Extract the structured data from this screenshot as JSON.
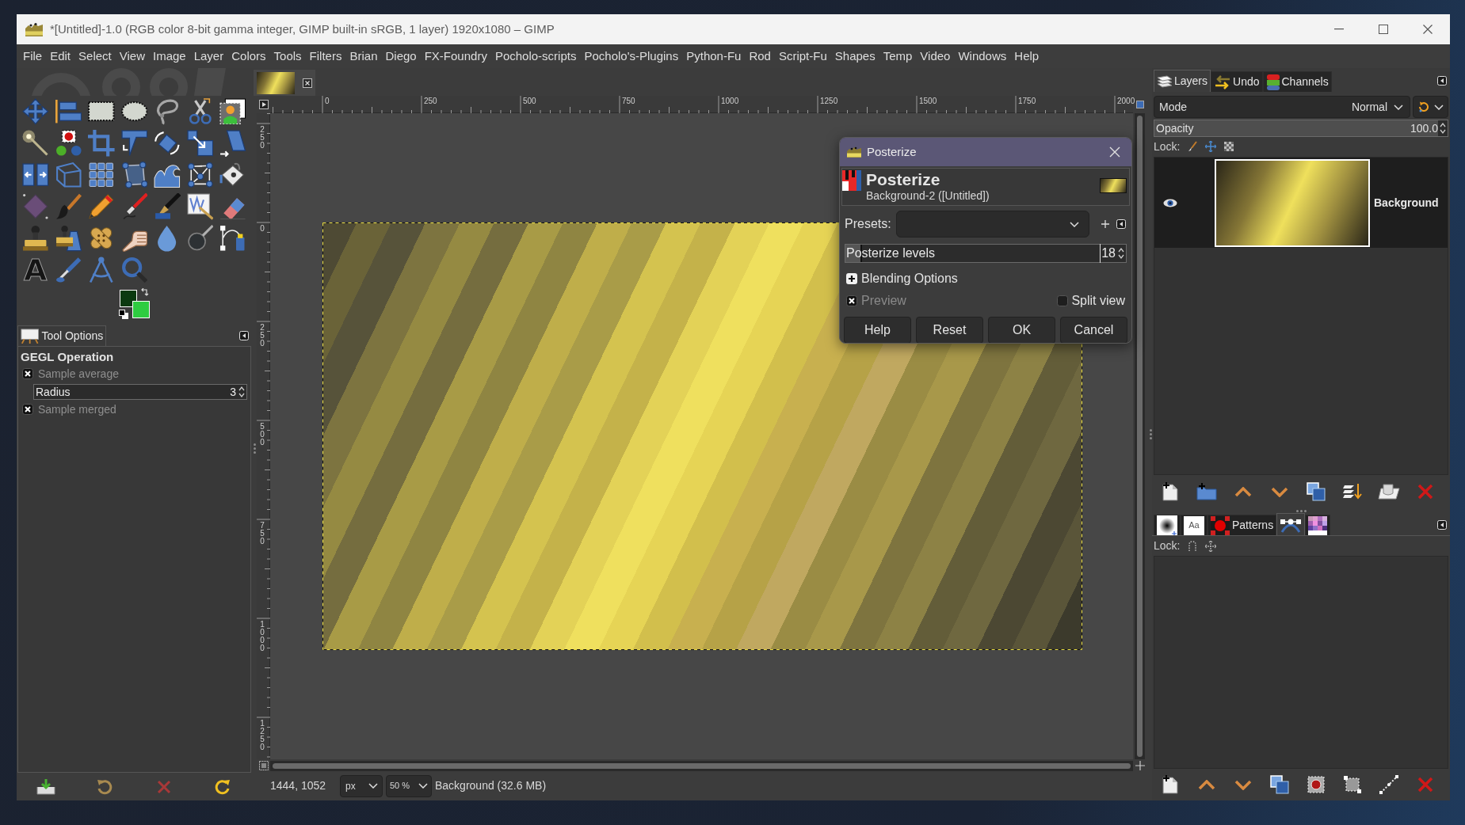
{
  "window": {
    "title": "*[Untitled]-1.0 (RGB color 8-bit gamma integer, GIMP built-in sRGB, 1 layer) 1920x1080 – GIMP"
  },
  "menu_bar": [
    "File",
    "Edit",
    "Select",
    "View",
    "Image",
    "Layer",
    "Colors",
    "Tools",
    "Filters",
    "Brian",
    "Diego",
    "FX-Foundry",
    "Pocholo-scripts",
    "Pocholo's-Plugins",
    "Python-Fu",
    "Rod",
    "Script-Fu",
    "Shapes",
    "Temp",
    "Video",
    "Windows",
    "Help"
  ],
  "toolbox": {
    "text_tool_glyph": "A"
  },
  "tool_options": {
    "tab": "Tool Options",
    "heading": "GEGL Operation",
    "options": [
      {
        "kind": "checkbox",
        "label": "Sample average",
        "checked": true,
        "disabled": true
      },
      {
        "kind": "spin",
        "label": "Radius",
        "value": "3"
      },
      {
        "kind": "checkbox",
        "label": "Sample merged",
        "checked": true,
        "disabled": true
      }
    ]
  },
  "rulers": {
    "horizontal": [
      "0",
      "250",
      "500",
      "750",
      "1000",
      "1250",
      "1500",
      "1750",
      "2000"
    ],
    "vertical": [
      "250",
      "0",
      "250",
      "500",
      "750",
      "1000",
      "1250"
    ]
  },
  "posterize_dialog": {
    "title": "Posterize",
    "heading": "Posterize",
    "subtitle": "Background-2 ([Untitled])",
    "presets": {
      "label": "Presets:"
    },
    "levels": {
      "label": "Posterize levels",
      "value": "18",
      "level": 0.06
    },
    "blending_options": {
      "label": "Blending Options",
      "expanded": false
    },
    "preview": {
      "label": "Preview",
      "checked": true,
      "disabled": true
    },
    "split_view": {
      "label": "Split view",
      "checked": false
    },
    "buttons": [
      "Help",
      "Reset",
      "OK",
      "Cancel"
    ]
  },
  "status_bar": {
    "coordinates": "1444, 1052",
    "unit": "px",
    "zoom": "50 %",
    "message": "Background (32.6 MB)"
  },
  "layers_dock": {
    "tabs": [
      {
        "kind": "layers",
        "label": "Layers",
        "selected": true
      },
      {
        "kind": "undo",
        "label": "Undo",
        "selected": false
      },
      {
        "kind": "channels",
        "label": "Channels",
        "selected": false
      }
    ],
    "mode": {
      "label": "Mode",
      "value": "Normal"
    },
    "opacity": {
      "label": "Opacity",
      "value": "100.0",
      "level": 1
    },
    "lock_label": "Lock:",
    "layers": [
      {
        "name": "Background",
        "visible": true,
        "selected": true
      }
    ]
  },
  "lower_dock": {
    "tabs": [
      {
        "kind": "brushes",
        "selected": false
      },
      {
        "kind": "fonts",
        "glyph": "Aa",
        "selected": false
      },
      {
        "kind": "patterns",
        "label": "Patterns",
        "selected": false
      },
      {
        "kind": "paths",
        "selected": true
      },
      {
        "kind": "palettes",
        "selected": false
      }
    ],
    "lock_label": "Lock:"
  }
}
